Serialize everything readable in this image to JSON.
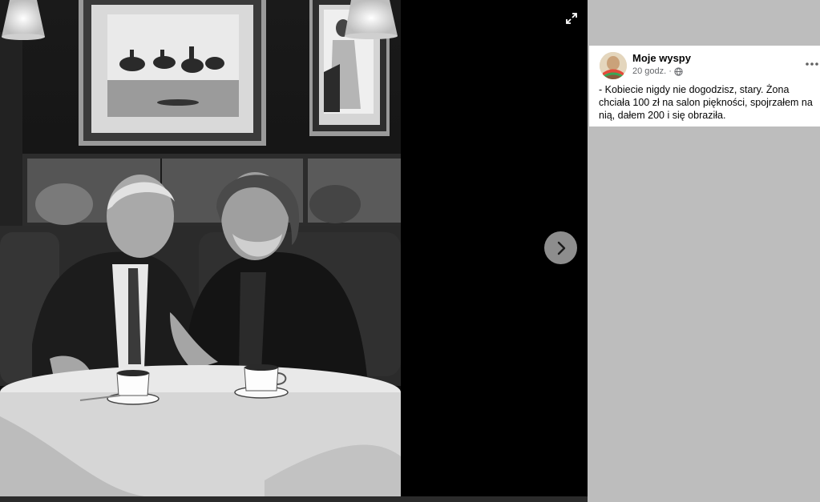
{
  "post": {
    "author": "Moje wyspy",
    "time": "20 godz.",
    "separator": "·",
    "text": "- Kobiecie nigdy nie dogodzisz, stary. Żona chciała 100 zł na salon piękności, spojrzałem na nią, dałem 200 i się obraziła."
  },
  "icons": {
    "expand": "expand-icon",
    "next": "chevron-right-icon",
    "privacy": "globe-icon",
    "more": "more-dots-icon"
  },
  "colors": {
    "viewer_bg": "#000000",
    "side_bg": "#bdbdbd",
    "post_bg": "#ffffff",
    "nav_button": "#8d8d8d",
    "meta_text": "#65676b"
  }
}
